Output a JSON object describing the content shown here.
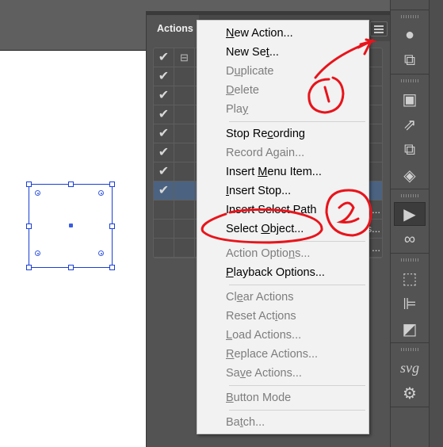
{
  "panel": {
    "title": "Actions",
    "menu_icon": "hamburger-icon"
  },
  "action_rows": [
    {
      "checked": true,
      "toggle": "collapse-icon",
      "text": ""
    },
    {
      "checked": true,
      "text": ""
    },
    {
      "checked": true,
      "text": ""
    },
    {
      "checked": true,
      "text": ""
    },
    {
      "checked": true,
      "text": ""
    },
    {
      "checked": true,
      "text": ""
    },
    {
      "checked": true,
      "text": ""
    },
    {
      "checked": true,
      "selected": true,
      "text": ""
    },
    {
      "checked": false,
      "text": "..."
    },
    {
      "checked": false,
      "text": "s..."
    },
    {
      "checked": false,
      "text": "..."
    }
  ],
  "menu": [
    {
      "label": "New Action...",
      "mnemonic": 0,
      "enabled": true
    },
    {
      "label": "New Set...",
      "mnemonic": 6,
      "enabled": true
    },
    {
      "label": "Duplicate",
      "mnemonic": 1,
      "enabled": false
    },
    {
      "label": "Delete",
      "mnemonic": 0,
      "enabled": false
    },
    {
      "label": "Play",
      "mnemonic": 3,
      "enabled": false
    },
    {
      "separator": true
    },
    {
      "label": "Stop Recording",
      "mnemonic": 7,
      "enabled": true
    },
    {
      "label": "Record Again...",
      "mnemonic": 8,
      "enabled": false
    },
    {
      "label": "Insert Menu Item...",
      "mnemonic": 7,
      "enabled": true
    },
    {
      "label": "Insert Stop...",
      "mnemonic": 0,
      "enabled": true
    },
    {
      "label": "Insert Select Path",
      "mnemonic": -1,
      "enabled": true
    },
    {
      "label": "Select Object...",
      "mnemonic": 7,
      "enabled": true
    },
    {
      "separator": true
    },
    {
      "label": "Action Options...",
      "mnemonic": 12,
      "enabled": false
    },
    {
      "label": "Playback Options...",
      "mnemonic": 0,
      "enabled": true
    },
    {
      "separator": true
    },
    {
      "label": "Clear Actions",
      "mnemonic": 2,
      "enabled": false
    },
    {
      "label": "Reset Actions",
      "mnemonic": 9,
      "enabled": false
    },
    {
      "label": "Load Actions...",
      "mnemonic": 0,
      "enabled": false
    },
    {
      "label": "Replace Actions...",
      "mnemonic": 0,
      "enabled": false
    },
    {
      "label": "Save Actions...",
      "mnemonic": 2,
      "enabled": false
    },
    {
      "separator": true
    },
    {
      "label": "Button Mode",
      "mnemonic": 0,
      "enabled": false
    },
    {
      "separator": true
    },
    {
      "label": "Batch...",
      "mnemonic": 2,
      "enabled": false
    }
  ],
  "toolbar_groups": [
    [
      {
        "icon": "color-guide-icon",
        "glyph": "●"
      },
      {
        "icon": "transform-icon",
        "glyph": "⧉"
      }
    ],
    [
      {
        "icon": "libraries-icon",
        "glyph": "▣"
      },
      {
        "icon": "export-icon",
        "glyph": "⇗"
      },
      {
        "icon": "artboards-icon",
        "glyph": "⧉"
      },
      {
        "icon": "layers-icon",
        "glyph": "◈"
      }
    ],
    [
      {
        "icon": "actions-play-icon",
        "glyph": "▶",
        "active": true
      },
      {
        "icon": "links-icon",
        "glyph": "∞"
      }
    ],
    [
      {
        "icon": "transform-bounds-icon",
        "glyph": "⬚"
      },
      {
        "icon": "align-icon",
        "glyph": "⊫"
      },
      {
        "icon": "pathfinder-icon",
        "glyph": "◩"
      }
    ],
    [
      {
        "icon": "svg-interactivity-icon",
        "glyph": "svg"
      },
      {
        "icon": "settings-gears-icon",
        "glyph": "⚙"
      }
    ]
  ],
  "annotations": [
    "1",
    "2"
  ],
  "annotation_color": "#e8141b",
  "selection_color": "#1a3fd6"
}
